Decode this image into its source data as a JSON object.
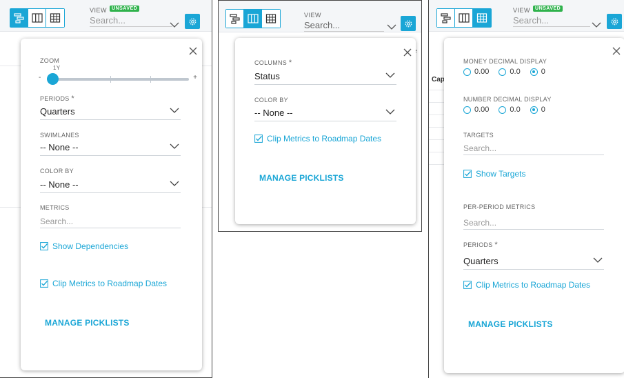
{
  "panel1": {
    "view_label": "VIEW",
    "unsaved": "UNSAVED",
    "search_placeholder": "Search...",
    "zoom_label": "ZOOM",
    "zoom_value": "1Y",
    "zoom_minus": "-",
    "zoom_plus": "+",
    "zoom_level": 0.0,
    "periods_label": "PERIODS",
    "periods_value": "Quarters",
    "swimlanes_label": "SWIMLANES",
    "swimlanes_value": "-- None --",
    "colorby_label": "COLOR BY",
    "colorby_value": "-- None --",
    "metrics_label": "METRICS",
    "metrics_placeholder": "Search...",
    "show_dependencies": "Show Dependencies",
    "clip_metrics": "Clip Metrics to Roadmap Dates",
    "manage_picklists": "MANAGE PICKLISTS"
  },
  "panel2": {
    "view_label": "VIEW",
    "search_placeholder": "Search...",
    "columns_label": "COLUMNS",
    "columns_value": "Status",
    "colorby_label": "COLOR BY",
    "colorby_value": "-- None --",
    "clip_metrics": "Clip Metrics to Roadmap Dates",
    "manage_picklists": "MANAGE PICKLISTS",
    "bg_fragment": "e"
  },
  "panel3": {
    "view_label": "VIEW",
    "unsaved": "UNSAVED",
    "search_placeholder": "Search...",
    "money_label": "MONEY DECIMAL DISPLAY",
    "money_options": [
      "0.00",
      "0.0",
      "0"
    ],
    "number_label": "NUMBER DECIMAL DISPLAY",
    "number_options": [
      "0.00",
      "0.0",
      "0"
    ],
    "targets_label": "TARGETS",
    "targets_placeholder": "Search...",
    "show_targets": "Show Targets",
    "per_period_label": "PER-PERIOD METRICS",
    "per_period_placeholder": "Search...",
    "periods_label": "PERIODS",
    "periods_value": "Quarters",
    "clip_metrics": "Clip Metrics to Roadmap Dates",
    "manage_picklists": "MANAGE PICKLISTS",
    "bg_fragment": "Cap"
  },
  "colors": {
    "accent": "#1aa6d6",
    "unsaved": "#2fb24c"
  }
}
